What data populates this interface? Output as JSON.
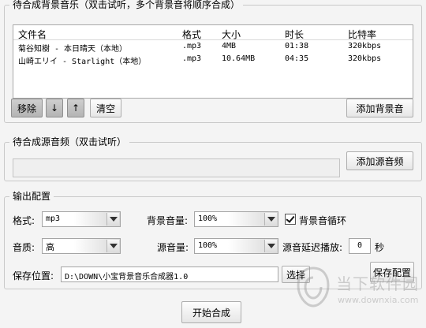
{
  "bg_group": {
    "title": "待合成背景音乐（双击试听，多个背景音将顺序合成）",
    "columns": [
      "文件名",
      "格式",
      "大小",
      "时长",
      "比特率"
    ],
    "rows": [
      [
        "菊谷知樹 - 本日晴天（本地）",
        ".mp3",
        "4MB",
        "01:38",
        "320kbps"
      ],
      [
        "山崎エリイ - Starlight（本地）",
        ".mp3",
        "10.64MB",
        "04:35",
        "320kbps"
      ]
    ],
    "remove_label": "移除",
    "down_label": "↓",
    "up_label": "↑",
    "clear_label": "清空",
    "add_label": "添加背景音"
  },
  "src_group": {
    "title": "待合成源音频（双击试听）",
    "add_label": "添加源音频"
  },
  "output_group": {
    "title": "输出配置",
    "format_label": "格式:",
    "format_value": "mp3",
    "bg_volume_label": "背景音量:",
    "bg_volume_value": "100%",
    "loop_label": "背景音循环",
    "loop_checked": true,
    "quality_label": "音质:",
    "quality_value": "高",
    "src_volume_label": "源音量:",
    "src_volume_value": "100%",
    "delay_label": "源音延迟播放:",
    "delay_value": "0",
    "delay_unit": "秒",
    "save_path_label": "保存位置:",
    "save_path_value": "D:\\DOWN\\小宝背景音乐合成器1.0",
    "browse_label": "选择",
    "save_config_label": "保存配置"
  },
  "start_label": "开始合成",
  "watermark": {
    "title": "当下软件园",
    "url": "www.downxia.com"
  }
}
